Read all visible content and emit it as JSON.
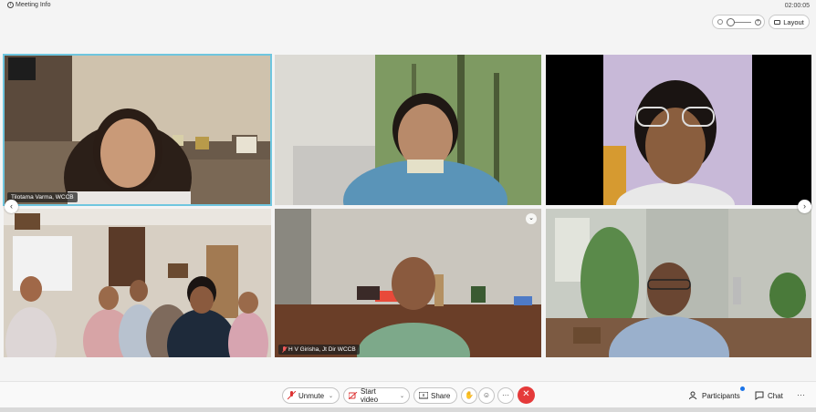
{
  "top": {
    "meeting_info": "Meeting Info",
    "timer": "02:00:05",
    "layout_label": "Layout"
  },
  "participants": [
    {
      "name": "Tilotama Varma, WCCB",
      "muted": false,
      "active": true
    },
    {
      "name": "",
      "muted": false,
      "active": false
    },
    {
      "name": "",
      "muted": false,
      "active": false
    },
    {
      "name": "",
      "muted": false,
      "active": false
    },
    {
      "name": "H V Girisha, Jt Dir WCCB",
      "muted": true,
      "active": false
    },
    {
      "name": "",
      "muted": false,
      "active": false
    }
  ],
  "toolbar": {
    "unmute": "Unmute",
    "start_video": "Start video",
    "share": "Share",
    "participants": "Participants",
    "chat": "Chat",
    "more": "···"
  },
  "colors": {
    "active_border": "#6fc6df",
    "end_call": "#e53a3a",
    "badge": "#1a73e8"
  }
}
